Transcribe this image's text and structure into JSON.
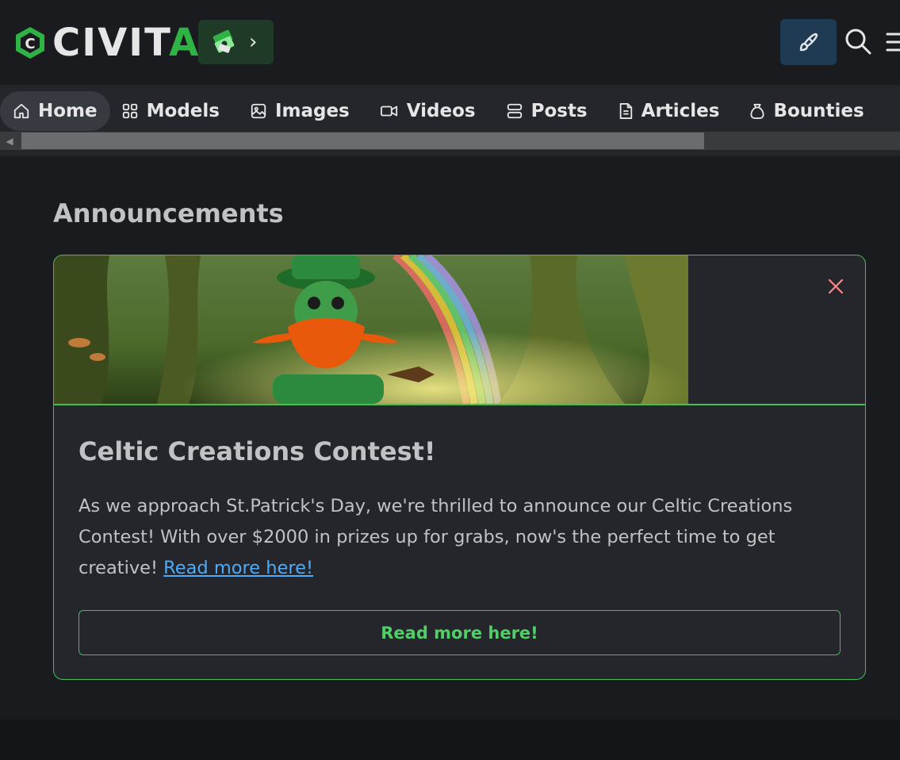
{
  "header": {
    "logo": {
      "part1": "CIVIT",
      "part2": "AI",
      "mark_icon": "civitai-logo-icon"
    },
    "buzz_button": {
      "icon": "buzz-money-icon",
      "chevron": "›"
    },
    "create_button_icon": "brush-icon",
    "search_icon": "search-icon",
    "menu_icon": "menu-icon"
  },
  "nav": {
    "tabs": [
      {
        "label": "Home",
        "icon": "home-icon",
        "active": true
      },
      {
        "label": "Models",
        "icon": "grid-icon",
        "active": false
      },
      {
        "label": "Images",
        "icon": "photo-icon",
        "active": false
      },
      {
        "label": "Videos",
        "icon": "video-icon",
        "active": false
      },
      {
        "label": "Posts",
        "icon": "layers-icon",
        "active": false
      },
      {
        "label": "Articles",
        "icon": "file-icon",
        "active": false
      },
      {
        "label": "Bounties",
        "icon": "moneybag-icon",
        "active": false
      }
    ]
  },
  "main": {
    "heading": "Announcements",
    "announcement": {
      "title": "Celtic Creations Contest!",
      "body": "As we approach St.Patrick's Day, we're thrilled to announce our Celtic Creations Contest! With over $2000 in prizes up for grabs, now's the perfect time to get creative! ",
      "link_text": "Read more here!",
      "cta_label": "Read more here!",
      "close_icon": "close-icon"
    }
  },
  "colors": {
    "background": "#1a1b1e",
    "surface": "#25262b",
    "accent_green": "#40c057",
    "link_blue": "#4dabf7",
    "close_red": "#ff8787"
  }
}
